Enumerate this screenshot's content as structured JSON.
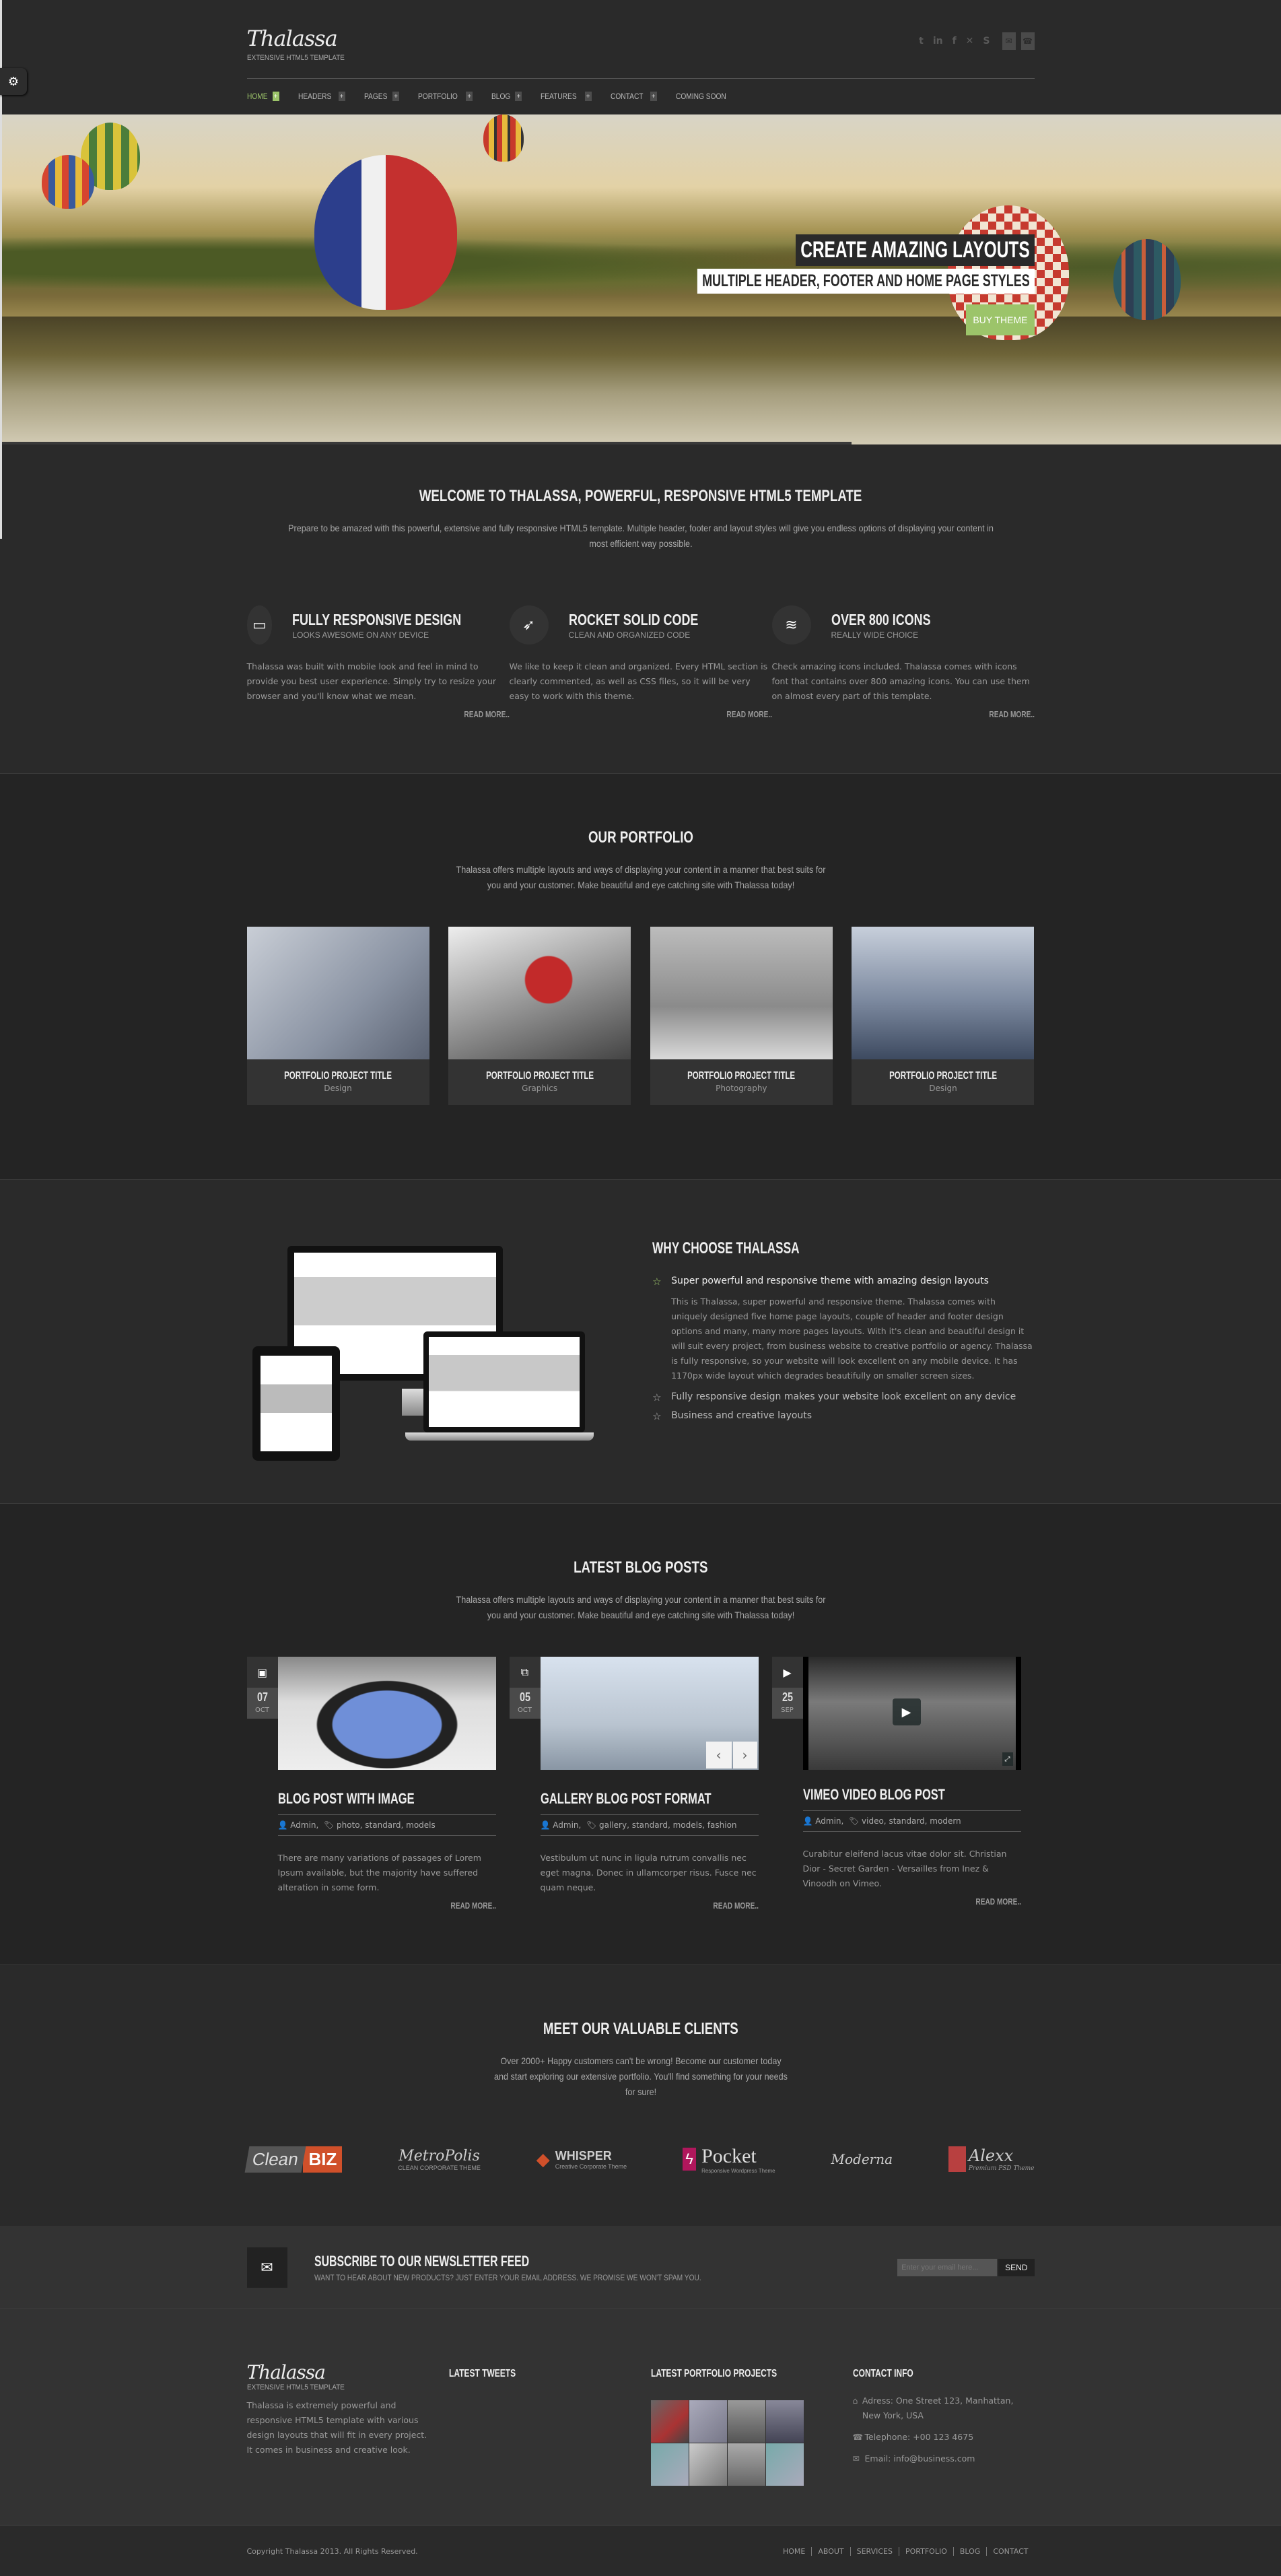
{
  "header": {
    "logo": "Thalassa",
    "tagline": "EXTENSIVE HTML5 TEMPLATE",
    "social_icons": [
      "twitter-icon",
      "linkedin-icon",
      "facebook-icon",
      "xing-icon",
      "skype-icon"
    ],
    "contact_icons": [
      "mail-icon",
      "phone-icon"
    ],
    "nav": [
      {
        "label": "HOME",
        "has_submenu": true,
        "active": true
      },
      {
        "label": "HEADERS",
        "has_submenu": true
      },
      {
        "label": "PAGES",
        "has_submenu": true
      },
      {
        "label": "PORTFOLIO",
        "has_submenu": true
      },
      {
        "label": "BLOG",
        "has_submenu": true
      },
      {
        "label": "FEATURES",
        "has_submenu": true
      },
      {
        "label": "CONTACT",
        "has_submenu": true
      },
      {
        "label": "COMING SOON",
        "has_submenu": false
      }
    ],
    "accent_color": "#9cc46a"
  },
  "hero": {
    "caption_line1": "CREATE AMAZING LAYOUTS",
    "caption_line2": "MULTIPLE HEADER, FOOTER AND HOME PAGE STYLES",
    "button": "BUY THEME"
  },
  "welcome": {
    "title": "WELCOME TO THALASSA, POWERFUL, RESPONSIVE HTML5 TEMPLATE",
    "text": "Prepare to be amazed with this powerful, extensive and fully responsive HTML5 template. Multiple header, footer and layout styles will give you endless options of displaying your content in most efficient way possible.",
    "features": [
      {
        "icon": "monitor-icon",
        "glyph": "🖥",
        "title": "FULLY RESPONSIVE DESIGN",
        "subtitle": "LOOKS AWESOME ON ANY DEVICE",
        "text": "Thalassa was built with mobile look and feel in mind to provide you best user experience. Simply try to resize your browser and you'll know what we mean.",
        "link": "READ MORE.."
      },
      {
        "icon": "rocket-icon",
        "glyph": "🚀",
        "title": "ROCKET SOLID CODE",
        "subtitle": "CLEAN AND ORGANIZED CODE",
        "text": "We like to keep it clean and organized. Every HTML section is clearly commented, as well as CSS files, so it will be very easy to work with this theme.",
        "link": "READ MORE.."
      },
      {
        "icon": "layers-icon",
        "glyph": "≋",
        "title": "OVER 800 ICONS",
        "subtitle": "REALLY WIDE CHOICE",
        "text": "Check amazing icons included. Thalassa comes with icons font that contains over 800 amazing icons. You can use them on almost every part of this template.",
        "link": "READ MORE.."
      }
    ]
  },
  "portfolio": {
    "title": "OUR PORTFOLIO",
    "text": "Thalassa offers multiple layouts and ways of displaying your content in a manner that best suits for you and your customer. Make beautiful and eye catching site with Thalassa today!",
    "items": [
      {
        "title": "PORTFOLIO PROJECT TITLE",
        "category": "Design"
      },
      {
        "title": "PORTFOLIO PROJECT TITLE",
        "category": "Graphics"
      },
      {
        "title": "PORTFOLIO PROJECT TITLE",
        "category": "Photography"
      },
      {
        "title": "PORTFOLIO PROJECT TITLE",
        "category": "Design"
      }
    ]
  },
  "why": {
    "title": "WHY CHOOSE THALASSA",
    "items": [
      {
        "label": "Super powerful and responsive theme with amazing design layouts",
        "expanded": true,
        "text": "This is Thalassa, super powerful and responsive theme. Thalassa comes with uniquely designed five home page layouts, couple of header and footer design options and many, many more pages layouts. With it's clean and beautiful design it will suit every project, from business website to creative portfolio or agency. Thalassa is fully responsive, so your website will look excellent on any mobile device. It has 1170px wide layout which degrades beautifully on smaller screen sizes."
      },
      {
        "label": "Fully responsive design makes your website look excellent on any device"
      },
      {
        "label": "Business and creative layouts"
      }
    ]
  },
  "blog": {
    "title": "LATEST BLOG POSTS",
    "text": "Thalassa offers multiple layouts and ways of displaying your content in a manner that best suits for you and your customer. Make beautiful and eye catching site with Thalassa today!",
    "posts": [
      {
        "type_icon": "image-icon",
        "day": "07",
        "month": "OCT",
        "title": "BLOG POST WITH IMAGE",
        "author": "Admin,",
        "tags": "photo, standard, models",
        "text": "There are many variations of passages of Lorem Ipsum available, but the majority have suffered alteration in some form.",
        "link": "READ MORE.."
      },
      {
        "type_icon": "gallery-icon",
        "day": "05",
        "month": "OCT",
        "title": "GALLERY BLOG POST FORMAT",
        "author": "Admin,",
        "tags": "gallery, standard, models, fashion",
        "text": "Vestibulum ut nunc in ligula rutrum convallis nec eget magna. Donec in ullamcorper risus. Fusce nec quam neque.",
        "link": "READ MORE.."
      },
      {
        "type_icon": "video-icon",
        "day": "25",
        "month": "SEP",
        "title": "VIMEO VIDEO BLOG POST",
        "author": "Admin,",
        "tags": "video, standard, modern",
        "text": "Curabitur eleifend lacus vitae dolor sit. Christian Dior - Secret Garden - Versailles from Inez & Vinoodh on Vimeo.",
        "link": "READ MORE.."
      }
    ]
  },
  "clients": {
    "title": "MEET OUR VALUABLE CLIENTS",
    "text": "Over 2000+ Happy customers can't be wrong! Become our customer today and start exploring our extensive portfolio. You'll find something for your needs for sure!",
    "logos": [
      {
        "name": "Clean",
        "accent": "BIZ"
      },
      {
        "name": "MetroPolis",
        "sub": "CLEAN CORPORATE THEME"
      },
      {
        "name": "WHISPER",
        "sub": "Creative Corporate Theme"
      },
      {
        "name": "Pocket",
        "sub": "Responsive Wordpress Theme"
      },
      {
        "name": "Moderna"
      },
      {
        "name": "Alexx",
        "sub": "Premium PSD Theme"
      }
    ]
  },
  "newsletter": {
    "title": "SUBSCRIBE TO OUR NEWSLETTER FEED",
    "subtitle": "WANT TO HEAR ABOUT NEW PRODUCTS? JUST ENTER YOUR EMAIL ADDRESS. WE PROMISE WE WON'T SPAM YOU.",
    "placeholder": "Enter your email here...",
    "button": "SEND"
  },
  "footer": {
    "logo": "Thalassa",
    "tagline": "EXTENSIVE HTML5 TEMPLATE",
    "about": "Thalassa is extremely powerful and responsive HTML5 template with various design layouts that will fit in every project. It comes in business and creative look.",
    "tweets_title": "LATEST TWEETS",
    "projects_title": "LATEST PORTFOLIO PROJECTS",
    "contact_title": "CONTACT INFO",
    "address": "Adress: One Street 123, Manhattan, New York, USA",
    "telephone": "Telephone: +00 123 4675",
    "email": "Email: info@business.com",
    "copyright": "Copyright Thalassa 2013. All Rights Reserved.",
    "links": [
      "HOME",
      "ABOUT",
      "SERVICES",
      "PORTFOLIO",
      "BLOG",
      "CONTACT"
    ]
  }
}
